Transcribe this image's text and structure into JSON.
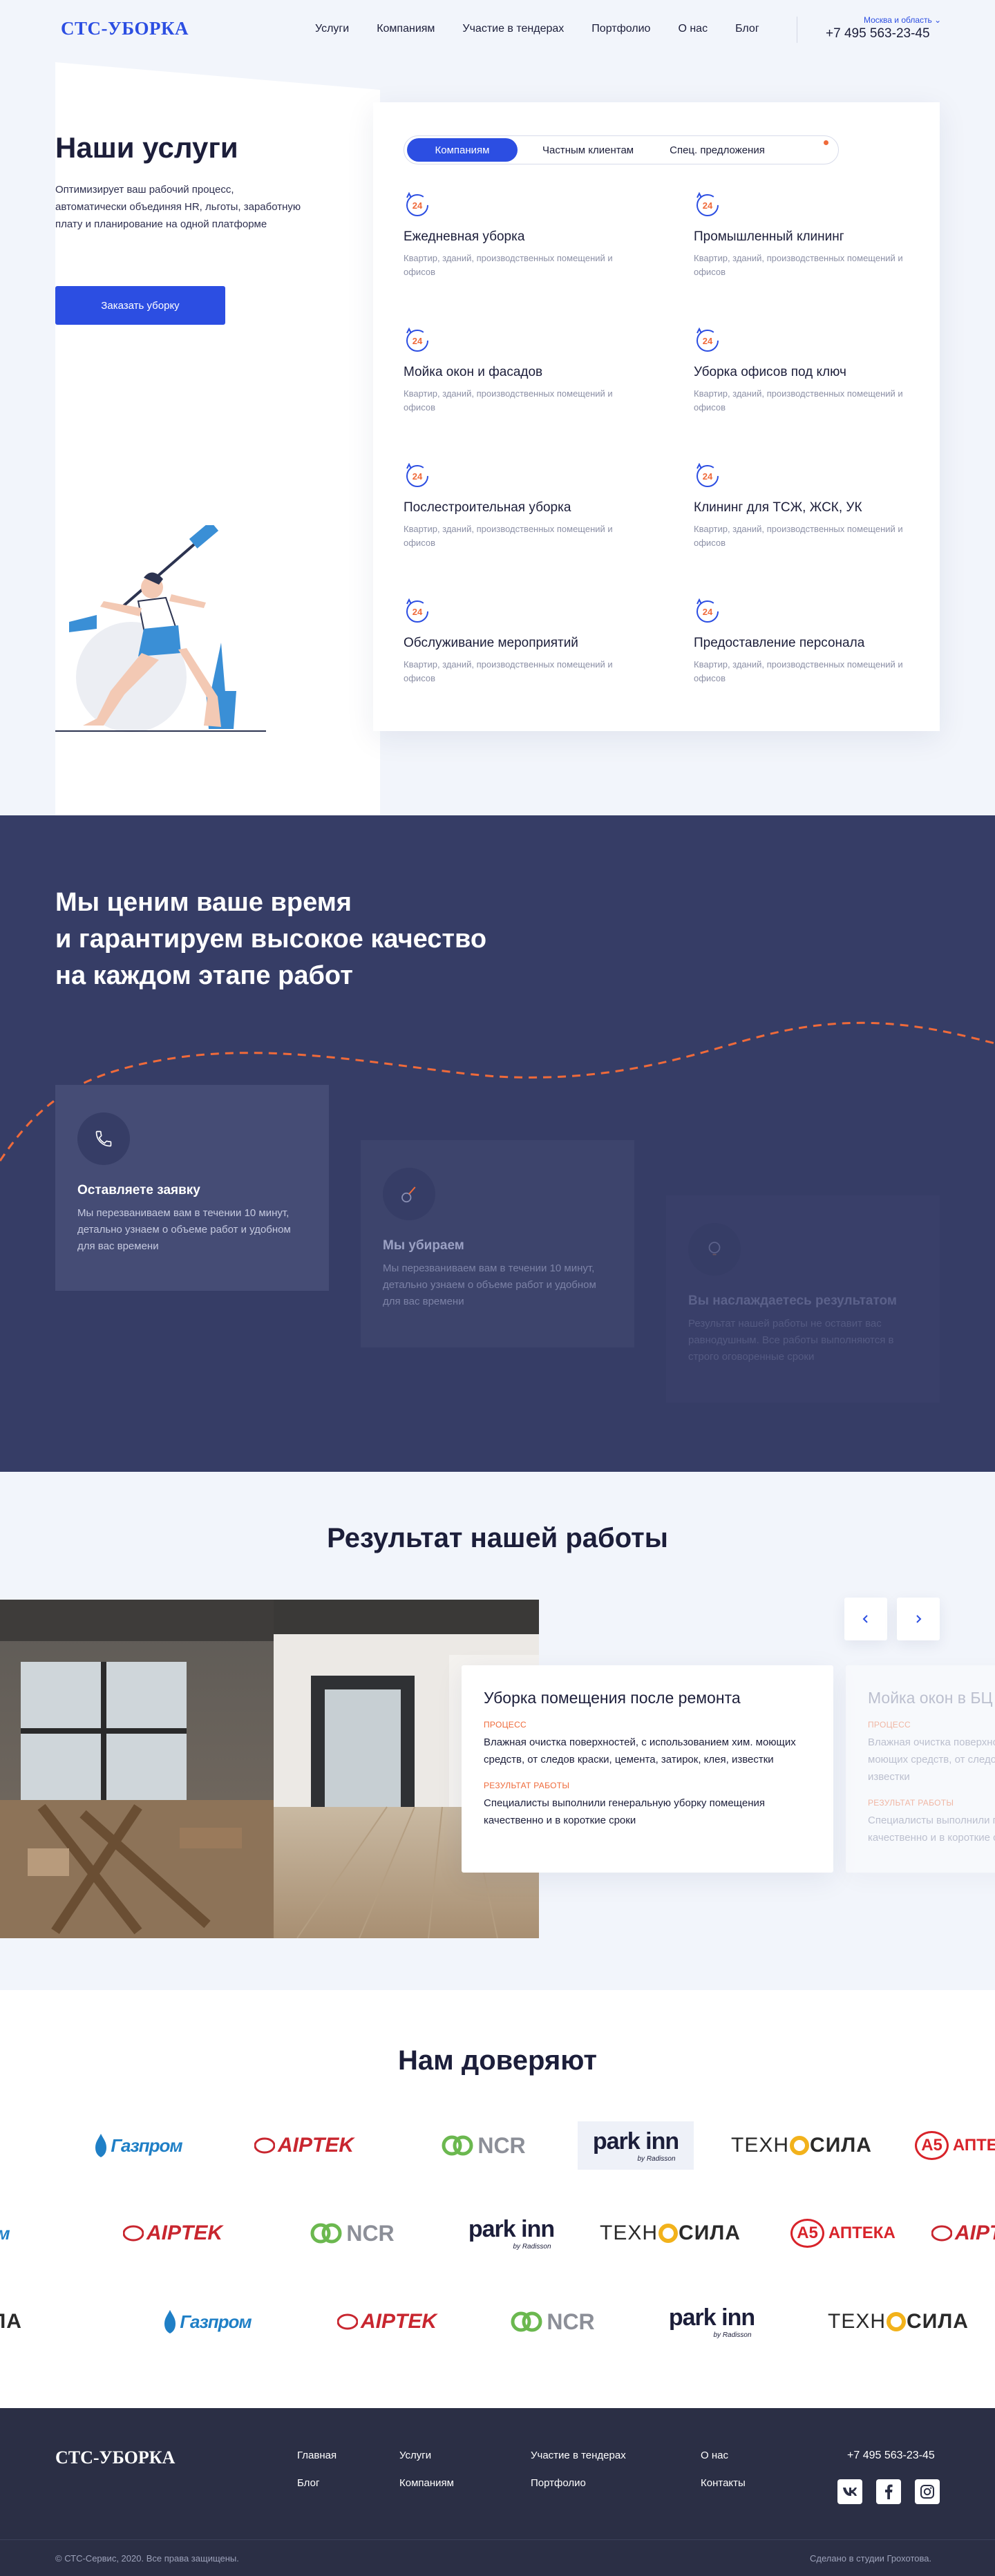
{
  "header": {
    "logo": "СТС-УБОРКА",
    "nav": [
      "Услуги",
      "Компаниям",
      "Участие в тендерах",
      "Портфолио",
      "О нас",
      "Блог"
    ],
    "region": "Москва и область",
    "phone": "+7 495 563-23-45"
  },
  "hero": {
    "title": "Наши услуги",
    "description": "Оптимизирует ваш рабочий процесс, автоматически объединяя HR, льготы, заработную плату и планирование на одной платформе",
    "cta": "Заказать уборку"
  },
  "services": {
    "tabs": [
      "Компаниям",
      "Частным клиентам",
      "Спец. предложения"
    ],
    "icon_text": "24",
    "items": [
      {
        "title": "Ежедневная уборка",
        "desc": "Квартир, зданий, производственных помещений и офисов"
      },
      {
        "title": "Промышленный клининг",
        "desc": "Квартир, зданий, производственных помещений и офисов"
      },
      {
        "title": "Мойка окон и фасадов",
        "desc": "Квартир, зданий, производственных помещений и офисов"
      },
      {
        "title": "Уборка офисов под ключ",
        "desc": "Квартир, зданий, производственных помещений и офисов"
      },
      {
        "title": "Послестроительная уборка",
        "desc": "Квартир, зданий, производственных помещений и офисов"
      },
      {
        "title": "Клининг для ТСЖ, ЖСК, УК",
        "desc": "Квартир, зданий, производственных помещений и офисов"
      },
      {
        "title": "Обслуживание мероприятий",
        "desc": "Квартир, зданий, производственных помещений и офисов"
      },
      {
        "title": "Предоставление персонала",
        "desc": "Квартир, зданий, производственных помещений и офисов"
      }
    ]
  },
  "process": {
    "title_lines": [
      "Мы ценим ваше время",
      "и гарантируем высокое качество",
      "на каждом этапе работ"
    ],
    "steps": [
      {
        "title": "Оставляете заявку",
        "desc": "Мы перезваниваем вам в течении 10 минут, детально узнаем о объеме работ и удобном для вас времени"
      },
      {
        "title": "Мы убираем",
        "desc": "Мы перезваниваем вам в течении 10 минут, детально узнаем о объеме работ и удобном для вас времени"
      },
      {
        "title": "Вы наслаждаетесь результатом",
        "desc": "Результат нашей работы не оставит вас равнодушным. Все работы выполняются в строго оговоренные сроки"
      }
    ]
  },
  "results": {
    "title": "Результат нашей работы",
    "cards": [
      {
        "title": "Уборка помещения после ремонта",
        "process_label": "ПРОЦЕСС",
        "process": "Влажная очистка поверхностей, с использованием хим. моющих средств, от следов краски, цемента, затирок, клея, известки",
        "result_label": "РЕЗУЛЬТАТ РАБОТЫ",
        "result": "Специалисты выполнили генеральную уборку помещения качественно и в короткие сроки"
      },
      {
        "title": "Мойка окон в БЦ",
        "process_label": "ПРОЦЕСС",
        "process": "Влажная очистка поверхностей, с использованием хим. моющих средств, от следов краски, цемента, затирок, клея, известки",
        "result_label": "РЕЗУЛЬТАТ РАБОТЫ",
        "result": "Специалисты выполнили генеральную уборку помещения качественно и в короткие сроки"
      }
    ]
  },
  "trust": {
    "title": "Нам доверяют",
    "logos": {
      "gazprom": "Газпром",
      "airtek": "AIPTEK",
      "ncr": "NCR",
      "parkinn": "park inn",
      "parkinn_sub": "by Radisson",
      "tekhnosila_a": "ТЕХН",
      "tekhnosila_b": "СИЛА",
      "a5": "A5",
      "a5_word": "АПТЕКА"
    }
  },
  "footer": {
    "logo": "СТС-УБОРКА",
    "links": [
      "Главная",
      "Блог",
      "Услуги",
      "Компаниям",
      "Участие в тендерах",
      "Портфолио",
      "О нас",
      "Контакты"
    ],
    "phone": "+7 495 563-23-45",
    "social": [
      "vk-icon",
      "facebook-icon",
      "instagram-icon"
    ],
    "copyright": "© СТС-Сервис, 2020. Все права защищены.",
    "studio": "Сделано в студии Грохотова."
  },
  "colors": {
    "accent": "#2c4ee2",
    "dark": "#363d66",
    "orange": "#ef6a3a",
    "footer": "#2b2f45"
  }
}
